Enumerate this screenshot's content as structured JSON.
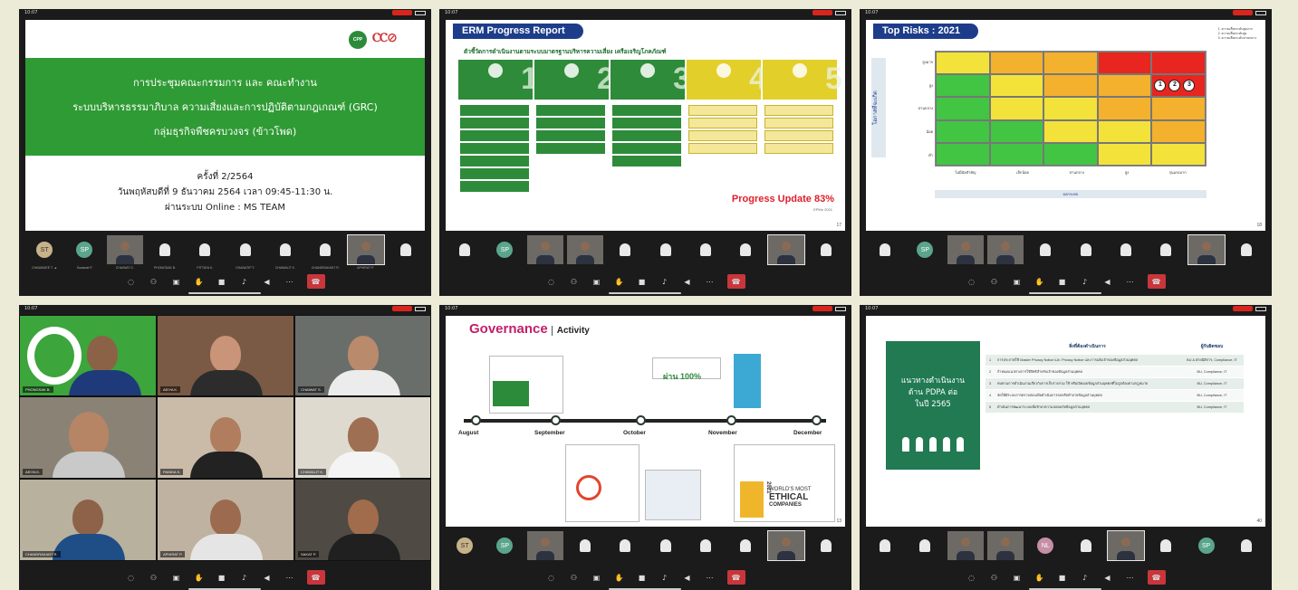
{
  "panels": {
    "p1": {
      "status_time": "10:07",
      "logo_cpp": "CPP",
      "band_lines": [
        "การประชุมคณะกรรมการ และ คณะทำงาน",
        "ระบบบริหารธรรมาภิบาล ความเสี่ยงและการปฏิบัติตามกฎเกณฑ์ (GRC)",
        "กลุ่มธุรกิจพืชครบวงจร (ข้าวโพด)"
      ],
      "sub_lines": [
        "ครั้งที่ 2/2564",
        "วันพฤหัสบดีที่ 9 ธันวาคม 2564 เวลา 09:45-11:30 น.",
        "ผ่านระบบ Online : MS TEAM"
      ],
      "thumbs": [
        {
          "type": "avatar",
          "initials": "ST",
          "cap": "CHAWADEE T. ▲"
        },
        {
          "type": "avatar",
          "initials": "SP",
          "cap": "Suwanat P."
        },
        {
          "type": "video",
          "cap": "CHAIWAT S."
        },
        {
          "type": "person",
          "cap": "PHONGSAK B."
        },
        {
          "type": "person",
          "cap": "PITTAYA K."
        },
        {
          "type": "person",
          "cap": "CHANATIP T."
        },
        {
          "type": "person",
          "cap": "CHAWALIT K."
        },
        {
          "type": "person",
          "cap": "CHANDRAKANT R."
        },
        {
          "type": "video",
          "cap": "APHIRAT P."
        },
        {
          "type": "person",
          "cap": ""
        }
      ]
    },
    "p2": {
      "title": "ERM Progress Report",
      "subtitle": "ตัวชี้วัดการดำเนินงานตามระบบมาตรฐานบริหารความเสี่ยง เครือเจริญโภคภัณฑ์",
      "step_nums": [
        "1",
        "2",
        "3",
        "4",
        "5"
      ],
      "progress": "Progress Update 83%",
      "progress_sub": "EPMo 2021",
      "slide_num": "17"
    },
    "p3": {
      "title": "Top Risks : 2021",
      "legend": [
        "1. ความเสี่ยงระดับสูงมาก",
        "2. ความเสี่ยงระดับสูง",
        "3. ความเสี่ยงระดับปานกลาง"
      ],
      "y_title": "โอกาสที่จะเกิด",
      "y_labels": [
        "สูงมาก",
        "สูง",
        "ปานกลาง",
        "น้อย",
        "ต่ำ"
      ],
      "x_labels": [
        "ไม่มีนัยสำคัญ",
        "เล็กน้อย",
        "ปานกลาง",
        "สูง",
        "รุนแรงมาก"
      ],
      "x_title": "ผลกระทบ",
      "risk_ids": [
        "1",
        "2",
        "3"
      ],
      "slide_num": "18"
    },
    "p4": {
      "names": [
        "PHONGSAK B.",
        "AEIYA K.",
        "CHAIWAT S.",
        "AEIYA K.",
        "PANIDA S.",
        "CHAWALIT K.",
        "CHANDRAKANT R.",
        "APHIRAT P.",
        "SAKAT P."
      ]
    },
    "p5": {
      "title_g": "Governance",
      "title_a": "Activity",
      "pass": "ผ่าน 100%",
      "months": [
        "August",
        "September",
        "October",
        "November",
        "December"
      ],
      "ethical_1": "WORLD'S MOST",
      "ethical_2": "ETHICAL",
      "ethical_3": "COMPANIES",
      "year": "2021",
      "slide_num": "13"
    },
    "p6": {
      "box_lines": [
        "แนวทางดำเนินงาน",
        "ด้าน PDPA ต่อ",
        "ในปี 2565"
      ],
      "th_item": "สิ่งที่ต้องดำเนินการ",
      "th_owner": "ผู้รับผิดชอบ",
      "rows": [
        {
          "n": "1",
          "item": "การประกาศใช้ Master Privacy Notice และ Privacy Notice และการแจ้งเจ้าของข้อมูลส่วนบุคคล",
          "owner": "BU & ฝ่ายนิติการ, Compliance, IT"
        },
        {
          "n": "2",
          "item": "กำหนดแนวทางการใช้สิทธิสำหรับเจ้าของข้อมูลส่วนบุคคล",
          "owner": "BU, Compliance, IT"
        },
        {
          "n": "3",
          "item": "ทบทวนการดำเนินงานเกี่ยวกับการเก็บรวบรวม ใช้ หรือเปิดเผยข้อมูลส่วนบุคคลที่ไม่ถูกต้องตามกฎหมาย",
          "owner": "BU, Compliance, IT"
        },
        {
          "n": "4",
          "item": "จัดให้มีระบบการตรวจสอบเพื่อดำเนินการลบหรือทำลายข้อมูลส่วนบุคคล",
          "owner": "BU, Compliance, IT"
        },
        {
          "n": "5",
          "item": "ดำเนินการพัฒนาระบบเพื่อรักษาความปลอดภัยข้อมูลส่วนบุคคล",
          "owner": "BU, Compliance, IT"
        }
      ],
      "slide_num": "40"
    }
  },
  "toolbar_icons": [
    "chat-icon",
    "people-icon",
    "share-icon",
    "raise-hand-icon",
    "camera-icon",
    "mic-icon",
    "speaker-icon",
    "more-icon",
    "hangup-icon"
  ]
}
